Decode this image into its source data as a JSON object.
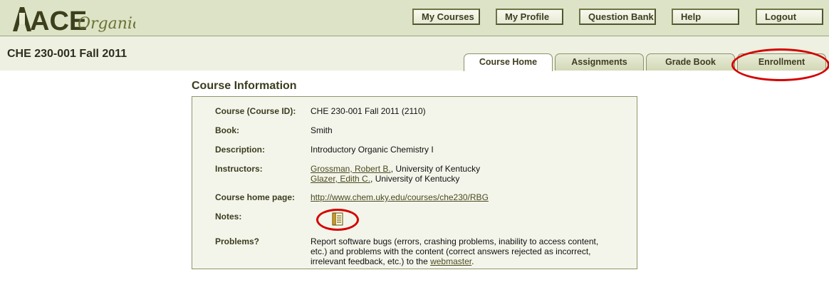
{
  "header": {
    "logo_text_bold": "ACE",
    "logo_text_script": "Organic",
    "nav": [
      "My Courses",
      "My Profile",
      "Question Bank",
      "Help",
      "Logout"
    ]
  },
  "course": {
    "title": "CHE 230-001 Fall 2011"
  },
  "tabs": [
    {
      "label": "Course Home",
      "active": true
    },
    {
      "label": "Assignments",
      "active": false
    },
    {
      "label": "Grade Book",
      "active": false
    },
    {
      "label": "Enrollment",
      "active": false
    }
  ],
  "info": {
    "heading": "Course Information",
    "course_id_label": "Course (Course ID):",
    "course_id_value": "CHE 230-001 Fall 2011 (2110)",
    "book_label": "Book:",
    "book_value": "Smith",
    "description_label": "Description:",
    "description_value": "Introductory Organic Chemistry I",
    "instructors_label": "Instructors:",
    "instructors": [
      {
        "name": "Grossman, Robert B.",
        "affiliation": ", University of Kentucky"
      },
      {
        "name": "Glazer, Edith C.",
        "affiliation": ", University of Kentucky"
      }
    ],
    "homepage_label": "Course home page:",
    "homepage_url": "http://www.chem.uky.edu/courses/che230/RBG",
    "notes_label": "Notes:",
    "notes_icon": "notes-icon",
    "problems_label": "Problems?",
    "problems_line1": "Report software bugs (errors, crashing problems, inability to access content,",
    "problems_line2": "etc.) and problems with the content (correct answers rejected as incorrect,",
    "problems_line3_pre": "irrelevant feedback, etc.) to the ",
    "problems_link": "webmaster",
    "problems_line3_post": "."
  },
  "colors": {
    "header_bg": "#dde3c6",
    "panel_bg": "#f4f5ea",
    "accent": "#6c7444",
    "annotation": "#d40000"
  }
}
